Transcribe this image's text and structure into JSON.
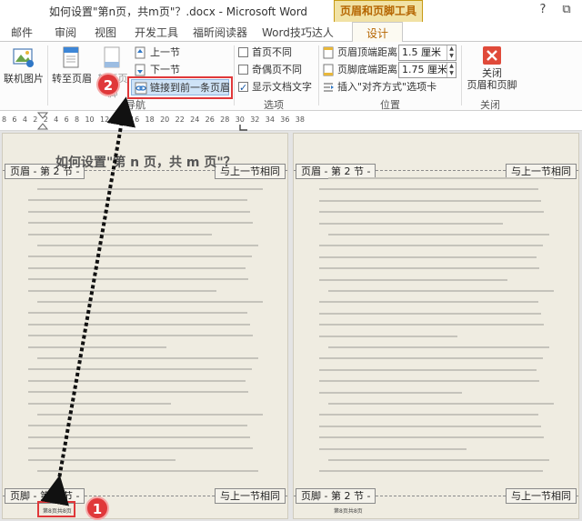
{
  "window": {
    "title": "如何设置\"第n页，共m页\"？.docx - Microsoft Word",
    "contextual_tab_group": "页眉和页脚工具",
    "help": "?",
    "restore": "⧉"
  },
  "tabs": [
    {
      "label": "邮件"
    },
    {
      "label": "审阅"
    },
    {
      "label": "视图"
    },
    {
      "label": "开发工具"
    },
    {
      "label": "福昕阅读器"
    },
    {
      "label": "Word技巧达人"
    },
    {
      "label": "设计",
      "active": true
    }
  ],
  "ribbon": {
    "insert_group": {
      "picture_label": "联机图片"
    },
    "nav_group": {
      "label": "导航",
      "goto_header": "转至页眉",
      "goto_footer": "转至页脚",
      "prev_section": "上一节",
      "next_section": "下一节",
      "link_previous": "链接到前一条页眉"
    },
    "options_group": {
      "label": "选项",
      "different_first": "首页不同",
      "different_odd_even": "奇偶页不同",
      "show_doc_text": "显示文档文字"
    },
    "position_group": {
      "label": "位置",
      "header_top_label": "页眉顶端距离:",
      "header_top_value": "1.5 厘米",
      "footer_bottom_label": "页脚底端距离:",
      "footer_bottom_value": "1.75 厘米",
      "insert_align_tab": "插入\"对齐方式\"选项卡"
    },
    "close_group": {
      "label": "关闭",
      "close_line1": "关闭",
      "close_line2": "页眉和页脚"
    }
  },
  "callouts": {
    "one": "1",
    "two": "2"
  },
  "ruler": {
    "numbers": "8 6 4 2 2 4 6 8 10 12 14 16 18 20 22 24 26 28 30 32 34 36 38"
  },
  "pages": {
    "left": {
      "header_tab": "页眉 - 第 2 节 -",
      "same_as_prev_top": "与上一节相同",
      "doc_title": "如何设置\"第 n 页，共 m 页\"？",
      "footer_tab": "页脚 - 第 2 节 -",
      "same_as_prev_bottom": "与上一节相同",
      "footer_field": "第8页共8页"
    },
    "right": {
      "header_tab": "页眉 - 第 2 节 -",
      "same_as_prev_top": "与上一节相同",
      "footer_tab": "页脚 - 第 2 节 -",
      "same_as_prev_bottom": "与上一节相同",
      "footer_field": "第8页共8页"
    }
  },
  "colors": {
    "accent": "#b56500",
    "callout_red": "#e0383a",
    "contextual_tab_bg": "#f1e2a5",
    "link_button_bg": "#cfe3f7"
  }
}
